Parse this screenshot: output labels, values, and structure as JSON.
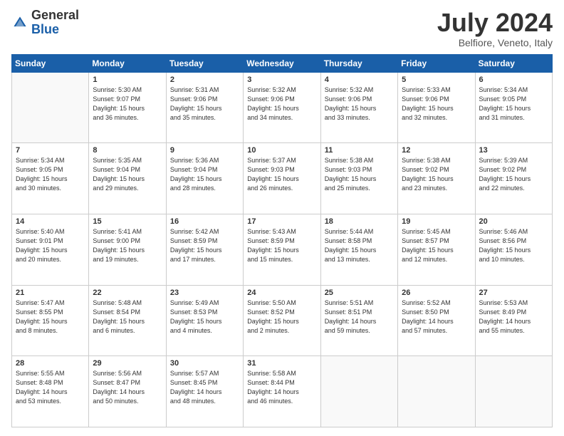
{
  "header": {
    "logo_general": "General",
    "logo_blue": "Blue",
    "month_title": "July 2024",
    "location": "Belfiore, Veneto, Italy"
  },
  "weekdays": [
    "Sunday",
    "Monday",
    "Tuesday",
    "Wednesday",
    "Thursday",
    "Friday",
    "Saturday"
  ],
  "weeks": [
    [
      {
        "day": "",
        "info": ""
      },
      {
        "day": "1",
        "info": "Sunrise: 5:30 AM\nSunset: 9:07 PM\nDaylight: 15 hours\nand 36 minutes."
      },
      {
        "day": "2",
        "info": "Sunrise: 5:31 AM\nSunset: 9:06 PM\nDaylight: 15 hours\nand 35 minutes."
      },
      {
        "day": "3",
        "info": "Sunrise: 5:32 AM\nSunset: 9:06 PM\nDaylight: 15 hours\nand 34 minutes."
      },
      {
        "day": "4",
        "info": "Sunrise: 5:32 AM\nSunset: 9:06 PM\nDaylight: 15 hours\nand 33 minutes."
      },
      {
        "day": "5",
        "info": "Sunrise: 5:33 AM\nSunset: 9:06 PM\nDaylight: 15 hours\nand 32 minutes."
      },
      {
        "day": "6",
        "info": "Sunrise: 5:34 AM\nSunset: 9:05 PM\nDaylight: 15 hours\nand 31 minutes."
      }
    ],
    [
      {
        "day": "7",
        "info": "Sunrise: 5:34 AM\nSunset: 9:05 PM\nDaylight: 15 hours\nand 30 minutes."
      },
      {
        "day": "8",
        "info": "Sunrise: 5:35 AM\nSunset: 9:04 PM\nDaylight: 15 hours\nand 29 minutes."
      },
      {
        "day": "9",
        "info": "Sunrise: 5:36 AM\nSunset: 9:04 PM\nDaylight: 15 hours\nand 28 minutes."
      },
      {
        "day": "10",
        "info": "Sunrise: 5:37 AM\nSunset: 9:03 PM\nDaylight: 15 hours\nand 26 minutes."
      },
      {
        "day": "11",
        "info": "Sunrise: 5:38 AM\nSunset: 9:03 PM\nDaylight: 15 hours\nand 25 minutes."
      },
      {
        "day": "12",
        "info": "Sunrise: 5:38 AM\nSunset: 9:02 PM\nDaylight: 15 hours\nand 23 minutes."
      },
      {
        "day": "13",
        "info": "Sunrise: 5:39 AM\nSunset: 9:02 PM\nDaylight: 15 hours\nand 22 minutes."
      }
    ],
    [
      {
        "day": "14",
        "info": "Sunrise: 5:40 AM\nSunset: 9:01 PM\nDaylight: 15 hours\nand 20 minutes."
      },
      {
        "day": "15",
        "info": "Sunrise: 5:41 AM\nSunset: 9:00 PM\nDaylight: 15 hours\nand 19 minutes."
      },
      {
        "day": "16",
        "info": "Sunrise: 5:42 AM\nSunset: 8:59 PM\nDaylight: 15 hours\nand 17 minutes."
      },
      {
        "day": "17",
        "info": "Sunrise: 5:43 AM\nSunset: 8:59 PM\nDaylight: 15 hours\nand 15 minutes."
      },
      {
        "day": "18",
        "info": "Sunrise: 5:44 AM\nSunset: 8:58 PM\nDaylight: 15 hours\nand 13 minutes."
      },
      {
        "day": "19",
        "info": "Sunrise: 5:45 AM\nSunset: 8:57 PM\nDaylight: 15 hours\nand 12 minutes."
      },
      {
        "day": "20",
        "info": "Sunrise: 5:46 AM\nSunset: 8:56 PM\nDaylight: 15 hours\nand 10 minutes."
      }
    ],
    [
      {
        "day": "21",
        "info": "Sunrise: 5:47 AM\nSunset: 8:55 PM\nDaylight: 15 hours\nand 8 minutes."
      },
      {
        "day": "22",
        "info": "Sunrise: 5:48 AM\nSunset: 8:54 PM\nDaylight: 15 hours\nand 6 minutes."
      },
      {
        "day": "23",
        "info": "Sunrise: 5:49 AM\nSunset: 8:53 PM\nDaylight: 15 hours\nand 4 minutes."
      },
      {
        "day": "24",
        "info": "Sunrise: 5:50 AM\nSunset: 8:52 PM\nDaylight: 15 hours\nand 2 minutes."
      },
      {
        "day": "25",
        "info": "Sunrise: 5:51 AM\nSunset: 8:51 PM\nDaylight: 14 hours\nand 59 minutes."
      },
      {
        "day": "26",
        "info": "Sunrise: 5:52 AM\nSunset: 8:50 PM\nDaylight: 14 hours\nand 57 minutes."
      },
      {
        "day": "27",
        "info": "Sunrise: 5:53 AM\nSunset: 8:49 PM\nDaylight: 14 hours\nand 55 minutes."
      }
    ],
    [
      {
        "day": "28",
        "info": "Sunrise: 5:55 AM\nSunset: 8:48 PM\nDaylight: 14 hours\nand 53 minutes."
      },
      {
        "day": "29",
        "info": "Sunrise: 5:56 AM\nSunset: 8:47 PM\nDaylight: 14 hours\nand 50 minutes."
      },
      {
        "day": "30",
        "info": "Sunrise: 5:57 AM\nSunset: 8:45 PM\nDaylight: 14 hours\nand 48 minutes."
      },
      {
        "day": "31",
        "info": "Sunrise: 5:58 AM\nSunset: 8:44 PM\nDaylight: 14 hours\nand 46 minutes."
      },
      {
        "day": "",
        "info": ""
      },
      {
        "day": "",
        "info": ""
      },
      {
        "day": "",
        "info": ""
      }
    ]
  ]
}
